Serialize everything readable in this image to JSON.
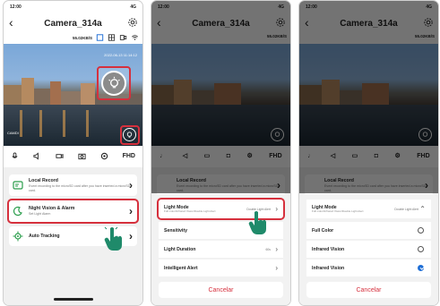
{
  "status": {
    "time": "12:00",
    "signal": "4G"
  },
  "header": {
    "title": "Camera_314a"
  },
  "camtools": {
    "speed": "55.02KB/S"
  },
  "video": {
    "timestamp": "2022-06-13 11:14:12",
    "cam_label": "CAMDI"
  },
  "toolbar": {
    "fhd": "FHD"
  },
  "menu": {
    "local_record": {
      "title": "Local Record",
      "desc": "Event recording to the microSD card after you have inserted a microSD card."
    },
    "night_vision": {
      "title": "Night Vision & Alarm",
      "desc": "Set Light Alarm"
    },
    "auto_tracking": {
      "title": "Auto Tracking"
    }
  },
  "sheet2": {
    "rows": [
      {
        "label": "Light Mode",
        "sub": "Full Color/Infrared Vision/Double Light Alert",
        "value": "Double Light Alert"
      },
      {
        "label": "Sensitivity",
        "sub": "",
        "value": ""
      },
      {
        "label": "Light Duration",
        "sub": "",
        "value": "60s"
      },
      {
        "label": "Intelligent Alert",
        "sub": "",
        "value": ""
      }
    ],
    "cancel": "Cancelar"
  },
  "sheet3": {
    "header": {
      "label": "Light Mode",
      "sub": "Full Color/Infrared Vision/Double Light Alert",
      "value": "Double Light Alert"
    },
    "options": [
      {
        "label": "Full Color",
        "selected": false
      },
      {
        "label": "Infrared Vision",
        "selected": false
      },
      {
        "label": "Infrared Vision",
        "selected": true
      }
    ],
    "cancel": "Cancelar"
  },
  "colors": {
    "accent_red": "#d6303d",
    "radio_blue": "#1f6fd6",
    "cancel_text": "#d6303d"
  }
}
